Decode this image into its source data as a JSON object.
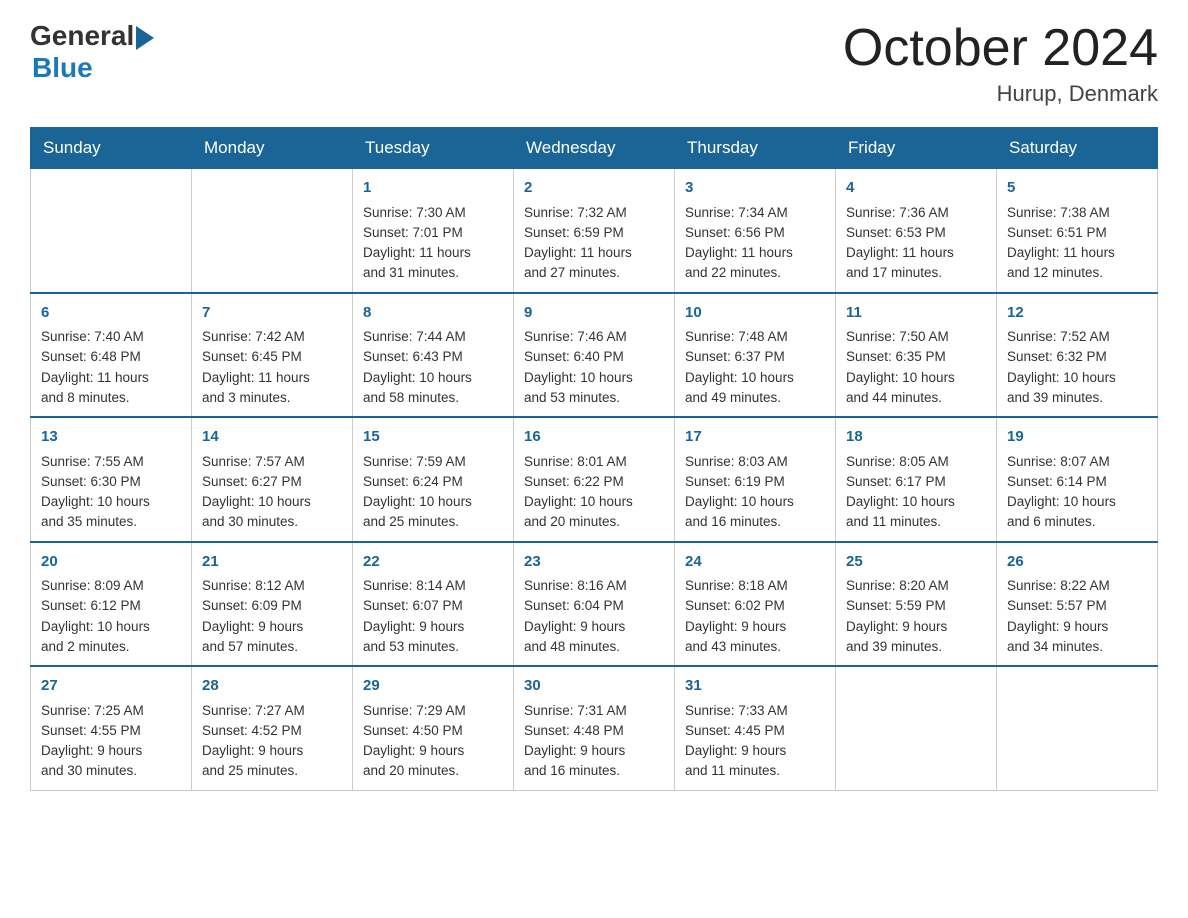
{
  "logo": {
    "general": "General",
    "blue": "Blue"
  },
  "title": "October 2024",
  "location": "Hurup, Denmark",
  "days": [
    "Sunday",
    "Monday",
    "Tuesday",
    "Wednesday",
    "Thursday",
    "Friday",
    "Saturday"
  ],
  "weeks": [
    [
      {
        "num": "",
        "text": ""
      },
      {
        "num": "",
        "text": ""
      },
      {
        "num": "1",
        "text": "Sunrise: 7:30 AM\nSunset: 7:01 PM\nDaylight: 11 hours\nand 31 minutes."
      },
      {
        "num": "2",
        "text": "Sunrise: 7:32 AM\nSunset: 6:59 PM\nDaylight: 11 hours\nand 27 minutes."
      },
      {
        "num": "3",
        "text": "Sunrise: 7:34 AM\nSunset: 6:56 PM\nDaylight: 11 hours\nand 22 minutes."
      },
      {
        "num": "4",
        "text": "Sunrise: 7:36 AM\nSunset: 6:53 PM\nDaylight: 11 hours\nand 17 minutes."
      },
      {
        "num": "5",
        "text": "Sunrise: 7:38 AM\nSunset: 6:51 PM\nDaylight: 11 hours\nand 12 minutes."
      }
    ],
    [
      {
        "num": "6",
        "text": "Sunrise: 7:40 AM\nSunset: 6:48 PM\nDaylight: 11 hours\nand 8 minutes."
      },
      {
        "num": "7",
        "text": "Sunrise: 7:42 AM\nSunset: 6:45 PM\nDaylight: 11 hours\nand 3 minutes."
      },
      {
        "num": "8",
        "text": "Sunrise: 7:44 AM\nSunset: 6:43 PM\nDaylight: 10 hours\nand 58 minutes."
      },
      {
        "num": "9",
        "text": "Sunrise: 7:46 AM\nSunset: 6:40 PM\nDaylight: 10 hours\nand 53 minutes."
      },
      {
        "num": "10",
        "text": "Sunrise: 7:48 AM\nSunset: 6:37 PM\nDaylight: 10 hours\nand 49 minutes."
      },
      {
        "num": "11",
        "text": "Sunrise: 7:50 AM\nSunset: 6:35 PM\nDaylight: 10 hours\nand 44 minutes."
      },
      {
        "num": "12",
        "text": "Sunrise: 7:52 AM\nSunset: 6:32 PM\nDaylight: 10 hours\nand 39 minutes."
      }
    ],
    [
      {
        "num": "13",
        "text": "Sunrise: 7:55 AM\nSunset: 6:30 PM\nDaylight: 10 hours\nand 35 minutes."
      },
      {
        "num": "14",
        "text": "Sunrise: 7:57 AM\nSunset: 6:27 PM\nDaylight: 10 hours\nand 30 minutes."
      },
      {
        "num": "15",
        "text": "Sunrise: 7:59 AM\nSunset: 6:24 PM\nDaylight: 10 hours\nand 25 minutes."
      },
      {
        "num": "16",
        "text": "Sunrise: 8:01 AM\nSunset: 6:22 PM\nDaylight: 10 hours\nand 20 minutes."
      },
      {
        "num": "17",
        "text": "Sunrise: 8:03 AM\nSunset: 6:19 PM\nDaylight: 10 hours\nand 16 minutes."
      },
      {
        "num": "18",
        "text": "Sunrise: 8:05 AM\nSunset: 6:17 PM\nDaylight: 10 hours\nand 11 minutes."
      },
      {
        "num": "19",
        "text": "Sunrise: 8:07 AM\nSunset: 6:14 PM\nDaylight: 10 hours\nand 6 minutes."
      }
    ],
    [
      {
        "num": "20",
        "text": "Sunrise: 8:09 AM\nSunset: 6:12 PM\nDaylight: 10 hours\nand 2 minutes."
      },
      {
        "num": "21",
        "text": "Sunrise: 8:12 AM\nSunset: 6:09 PM\nDaylight: 9 hours\nand 57 minutes."
      },
      {
        "num": "22",
        "text": "Sunrise: 8:14 AM\nSunset: 6:07 PM\nDaylight: 9 hours\nand 53 minutes."
      },
      {
        "num": "23",
        "text": "Sunrise: 8:16 AM\nSunset: 6:04 PM\nDaylight: 9 hours\nand 48 minutes."
      },
      {
        "num": "24",
        "text": "Sunrise: 8:18 AM\nSunset: 6:02 PM\nDaylight: 9 hours\nand 43 minutes."
      },
      {
        "num": "25",
        "text": "Sunrise: 8:20 AM\nSunset: 5:59 PM\nDaylight: 9 hours\nand 39 minutes."
      },
      {
        "num": "26",
        "text": "Sunrise: 8:22 AM\nSunset: 5:57 PM\nDaylight: 9 hours\nand 34 minutes."
      }
    ],
    [
      {
        "num": "27",
        "text": "Sunrise: 7:25 AM\nSunset: 4:55 PM\nDaylight: 9 hours\nand 30 minutes."
      },
      {
        "num": "28",
        "text": "Sunrise: 7:27 AM\nSunset: 4:52 PM\nDaylight: 9 hours\nand 25 minutes."
      },
      {
        "num": "29",
        "text": "Sunrise: 7:29 AM\nSunset: 4:50 PM\nDaylight: 9 hours\nand 20 minutes."
      },
      {
        "num": "30",
        "text": "Sunrise: 7:31 AM\nSunset: 4:48 PM\nDaylight: 9 hours\nand 16 minutes."
      },
      {
        "num": "31",
        "text": "Sunrise: 7:33 AM\nSunset: 4:45 PM\nDaylight: 9 hours\nand 11 minutes."
      },
      {
        "num": "",
        "text": ""
      },
      {
        "num": "",
        "text": ""
      }
    ]
  ]
}
